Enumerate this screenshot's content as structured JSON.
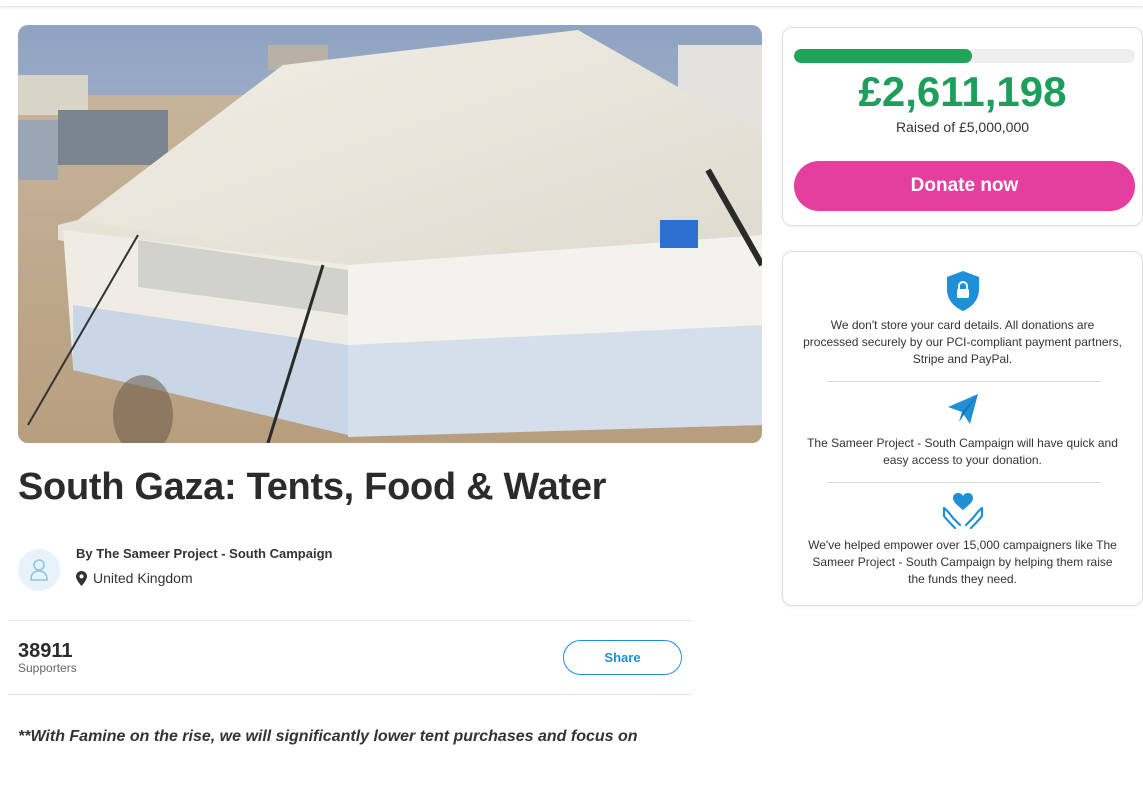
{
  "campaign": {
    "title": "South Gaza: Tents, Food & Water",
    "organiser": "By The Sameer Project - South Campaign",
    "location": "United Kingdom",
    "supporters_count": "38911",
    "supporters_label": "Supporters",
    "share_label": "Share",
    "description_excerpt": "**With Famine on the rise, we will significantly lower tent purchases and focus on"
  },
  "donation": {
    "raised_amount": "£2,611,198",
    "target_text": "Raised of £5,000,000",
    "progress_fraction": 0.522,
    "donate_label": "Donate now"
  },
  "trust": {
    "items": [
      {
        "icon": "shield-lock-icon",
        "text": "We don't store your card details. All donations are processed securely by our PCI-compliant payment partners, Stripe and PayPal."
      },
      {
        "icon": "paper-plane-icon",
        "text": "The Sameer Project - South Campaign will have quick and easy access to your donation."
      },
      {
        "icon": "hands-heart-icon",
        "text": "We've helped empower over 15,000 campaigners like The Sameer Project - South Campaign by helping them raise the funds they need."
      }
    ]
  },
  "colors": {
    "progress": "#20a35a",
    "raised": "#1d9e5b",
    "donate_button": "#e43e9e",
    "accent_blue": "#1f90d8"
  }
}
